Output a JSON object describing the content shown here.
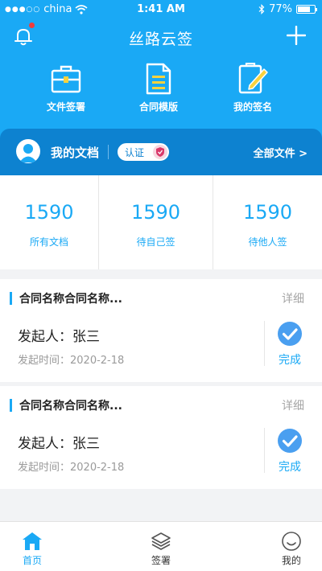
{
  "status_bar": {
    "carrier": "china",
    "time": "1:41 AM",
    "battery": "77%",
    "battery_level": 0.77
  },
  "nav": {
    "title": "丝路云签",
    "left_icon": "bell-icon",
    "right_icon": "plus-icon",
    "has_notification": true
  },
  "quick_actions": [
    {
      "label": "文件签署",
      "icon": "briefcase-icon"
    },
    {
      "label": "合同模版",
      "icon": "document-icon"
    },
    {
      "label": "我的签名",
      "icon": "signature-icon"
    }
  ],
  "doc_bar": {
    "title": "我的文档",
    "certified": "认证",
    "all_files": "全部文件 >"
  },
  "stats": [
    {
      "value": "1590",
      "label": "所有文档"
    },
    {
      "value": "1590",
      "label": "待自己签"
    },
    {
      "value": "1590",
      "label": "待他人签"
    }
  ],
  "cards": [
    {
      "title": "合同名称合同名称...",
      "detail": "详细",
      "initiator": "发起人：张三",
      "time": "发起时间：2020-2-18",
      "status": "完成"
    },
    {
      "title": "合同名称合同名称...",
      "detail": "详细",
      "initiator": "发起人：张三",
      "time": "发起时间：2020-2-18",
      "status": "完成"
    }
  ],
  "tabs": [
    {
      "label": "首页",
      "icon": "home-icon",
      "active": true
    },
    {
      "label": "签署",
      "icon": "layers-icon",
      "active": false
    },
    {
      "label": "我的",
      "icon": "smiley-icon",
      "active": false
    }
  ],
  "colors": {
    "primary": "#1aa9f5",
    "doc_bar": "#0d82d0",
    "notification": "#f03c3c"
  }
}
